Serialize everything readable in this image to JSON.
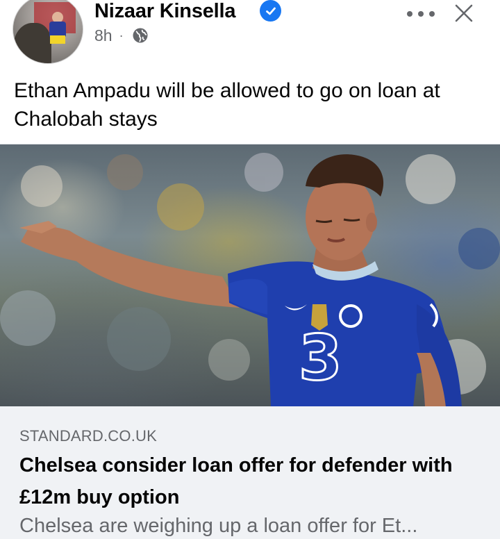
{
  "post": {
    "author": "Nizaar Kinsella",
    "verified": true,
    "time": "8h",
    "separator": "·",
    "audience_icon": "globe-icon",
    "text": "Ethan Ampadu will be allowed to go on loan at Chalobah stays"
  },
  "actions": {
    "more_icon": "ellipsis-icon",
    "close_icon": "close-icon"
  },
  "link_preview": {
    "domain": "STANDARD.CO.UK",
    "title": "Chelsea consider loan offer for defender with £12m buy option",
    "description": "Chelsea are weighing up a loan offer for Et..."
  },
  "colors": {
    "verified_badge": "#1877f2",
    "secondary_text": "#65676b",
    "link_meta_bg": "#f0f2f5"
  }
}
